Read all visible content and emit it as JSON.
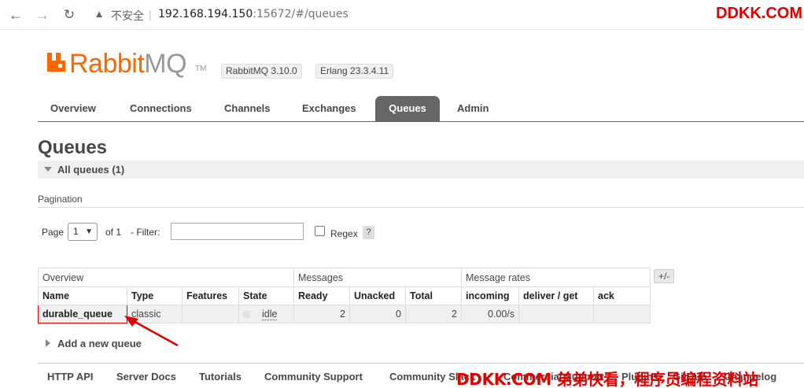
{
  "browser": {
    "security_label": "不安全",
    "url_host": "192.168.194.150",
    "url_rest": ":15672/#/queues"
  },
  "watermark": {
    "top": "DDKK.COM",
    "bottom": "DDKK.COM 弟弟快看，程序员编程资料站"
  },
  "header": {
    "logo_rabbit": "Rabbit",
    "logo_mq": "MQ",
    "logo_tm": "TM",
    "rabbitmq_version": "RabbitMQ 3.10.0",
    "erlang_version": "Erlang 23.3.4.11"
  },
  "tabs": [
    {
      "label": "Overview",
      "active": false
    },
    {
      "label": "Connections",
      "active": false
    },
    {
      "label": "Channels",
      "active": false
    },
    {
      "label": "Exchanges",
      "active": false
    },
    {
      "label": "Queues",
      "active": true
    },
    {
      "label": "Admin",
      "active": false
    }
  ],
  "page": {
    "title": "Queues",
    "section": "All queues (1)",
    "pagination_label": "Pagination"
  },
  "filter": {
    "page_label": "Page",
    "page_value": "1",
    "of_label": "of 1",
    "filter_label": "- Filter:",
    "filter_value": "",
    "regex_label": "Regex",
    "regex_checked": false,
    "help": "?"
  },
  "table": {
    "groups": [
      "Overview",
      "Messages",
      "Message rates"
    ],
    "columns": [
      "Name",
      "Type",
      "Features",
      "State",
      "Ready",
      "Unacked",
      "Total",
      "incoming",
      "deliver / get",
      "ack"
    ],
    "toggle": "+/-",
    "rows": [
      {
        "name": "durable_queue",
        "type": "classic",
        "features": "",
        "state": "idle",
        "ready": "2",
        "unacked": "0",
        "total": "2",
        "incoming": "0.00/s",
        "deliver_get": "",
        "ack": ""
      }
    ]
  },
  "add_queue": "Add a new queue",
  "footer": [
    "HTTP API",
    "Server Docs",
    "Tutorials",
    "Community Support",
    "Community Slack",
    "Commercial Support",
    "Plugins",
    "GitHub",
    "Changelog"
  ],
  "colors": {
    "brand": "#ff6600",
    "annotation": "#e00000",
    "tab_active": "#666666"
  }
}
